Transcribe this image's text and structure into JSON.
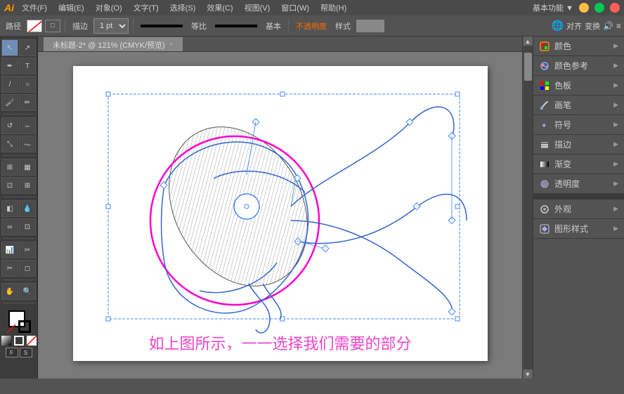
{
  "app": {
    "logo": "Ai",
    "title": "Adobe Illustrator"
  },
  "titlebar": {
    "menu_items": [
      "文件(F)",
      "编辑(E)",
      "对象(O)",
      "文字(T)",
      "选择(S)",
      "效果(C)",
      "视图(V)",
      "窗口(W)",
      "帮助(H)"
    ],
    "workspace": "基本功能 ▼",
    "window_buttons": [
      "−",
      "□",
      "×"
    ]
  },
  "toolbar": {
    "path_label": "路径",
    "stroke_label": "描边",
    "stroke_size": "1 pt",
    "line_type": "等比",
    "base_label": "基本",
    "opacity_label": "不透明度",
    "style_label": "样式",
    "align_label": "对齐",
    "transform_label": "变换"
  },
  "tab": {
    "title": "未标题-2* @ 121% (CMYK/预览)",
    "close": "×"
  },
  "right_panel": {
    "items": [
      {
        "icon": "color",
        "label": "颜色"
      },
      {
        "icon": "color-ref",
        "label": "颜色参考"
      },
      {
        "icon": "swatch",
        "label": "色板"
      },
      {
        "icon": "brush",
        "label": "画笔"
      },
      {
        "icon": "symbol",
        "label": "符号"
      },
      {
        "icon": "stroke",
        "label": "描边"
      },
      {
        "icon": "gradient",
        "label": "渐变"
      },
      {
        "icon": "opacity",
        "label": "透明度"
      },
      {
        "icon": "appearance",
        "label": "外观"
      },
      {
        "icon": "style",
        "label": "图形样式"
      }
    ]
  },
  "canvas": {
    "caption": "如上图所示，一一选择我们需要的部分"
  }
}
